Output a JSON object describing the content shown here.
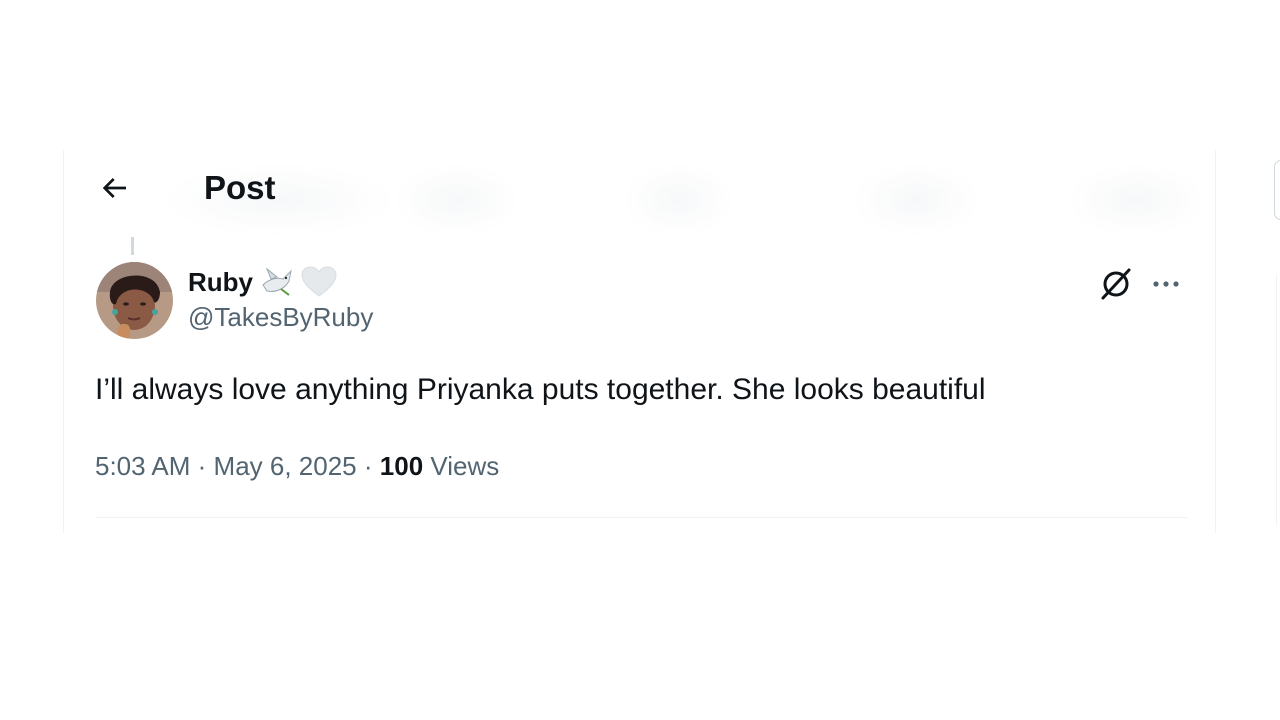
{
  "header": {
    "title": "Post",
    "back_icon": "arrow-left-icon"
  },
  "post": {
    "author": {
      "display_name": "Ruby",
      "name_emojis": [
        "dove-emoji",
        "white-heart-emoji"
      ],
      "handle": "@TakesByRuby"
    },
    "text": "I’ll always love anything Priyanka puts together. She looks beautiful",
    "time": "5:03 AM",
    "separator": "·",
    "date": "May 6, 2025",
    "views_count": "100",
    "views_label": "Views",
    "actions": {
      "grok_icon": "grok-icon",
      "more_icon": "more-horizontal-icon"
    }
  },
  "colors": {
    "text_primary": "#0f1419",
    "text_secondary": "#536471",
    "border": "#eff3f4"
  }
}
